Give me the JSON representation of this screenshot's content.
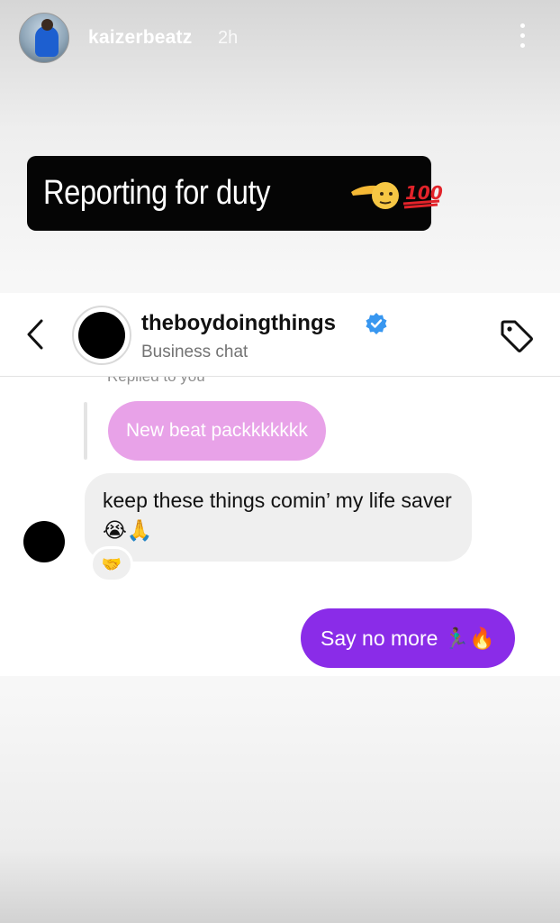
{
  "story": {
    "username": "kaizerbeatz",
    "time": "2h",
    "more_icon": "more-vertical-icon",
    "caption": "Reporting for duty",
    "caption_emojis": "🫡💯"
  },
  "chat": {
    "contact_name": "theboydoingthings",
    "verified": true,
    "subtitle": "Business chat",
    "back_icon": "chevron-left-icon",
    "tag_icon": "tag-icon",
    "replied_label": "Replied to you",
    "messages": [
      {
        "direction": "reply-quote",
        "text": "New beat packkkkkkk"
      },
      {
        "direction": "incoming",
        "text": "keep these things comin’ my life saver 😭🙏",
        "reaction": "🤝"
      },
      {
        "direction": "outgoing",
        "text": "Say no more 🏃🏾‍♂️🔥"
      }
    ]
  },
  "colors": {
    "outgoing_bubble": "#8a2ce8",
    "reply_bubble": "#e8a2e8",
    "incoming_bubble": "#efefef",
    "verified": "#3897f0"
  }
}
